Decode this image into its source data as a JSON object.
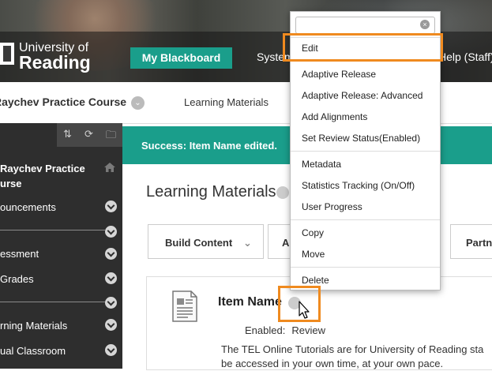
{
  "header": {
    "logo_line1": "University of",
    "logo_line2": "Reading",
    "nav_active": "My Blackboard",
    "nav_system": "System",
    "nav_help": "Help (Staff)"
  },
  "breadcrumb": {
    "course": "Raychev Practice Course",
    "current": "Learning Materials"
  },
  "sidebar": {
    "course_title_line1": "Raychev Practice",
    "course_title_line2": "urse",
    "items": [
      {
        "label": "ouncements"
      },
      {
        "label": "essment"
      },
      {
        "label": "Grades"
      },
      {
        "label": "rning Materials"
      },
      {
        "label": "ual Classroom"
      }
    ]
  },
  "success_message": "Success: Item Name edited.",
  "page_title": "Learning Materials",
  "toolbar": {
    "build_content": "Build Content",
    "assessments": "A",
    "partner": "Partn"
  },
  "item": {
    "name": "Item Name",
    "enabled_label": "Enabled:",
    "enabled_value": "Review",
    "desc_line1": "The TEL Online Tutorials are for University of Reading sta",
    "desc_line2": "be accessed in your own time, at your own pace."
  },
  "context_menu": {
    "items": [
      "Edit",
      "Adaptive Release",
      "Adaptive Release: Advanced",
      "Add Alignments",
      "Set Review Status(Enabled)",
      "Metadata",
      "Statistics Tracking (On/Off)",
      "User Progress",
      "Copy",
      "Move",
      "Delete"
    ]
  },
  "colors": {
    "accent_teal": "#1a9e8b",
    "highlight_orange": "#ef8a1f",
    "sidebar_bg": "#2e2e2e"
  },
  "icons": {
    "search_clear": "close-circle-icon",
    "sort": "sort-arrows-icon",
    "refresh": "refresh-icon",
    "folder": "folder-icon",
    "home": "home-icon",
    "document": "document-icon",
    "cursor": "mouse-pointer-icon"
  }
}
